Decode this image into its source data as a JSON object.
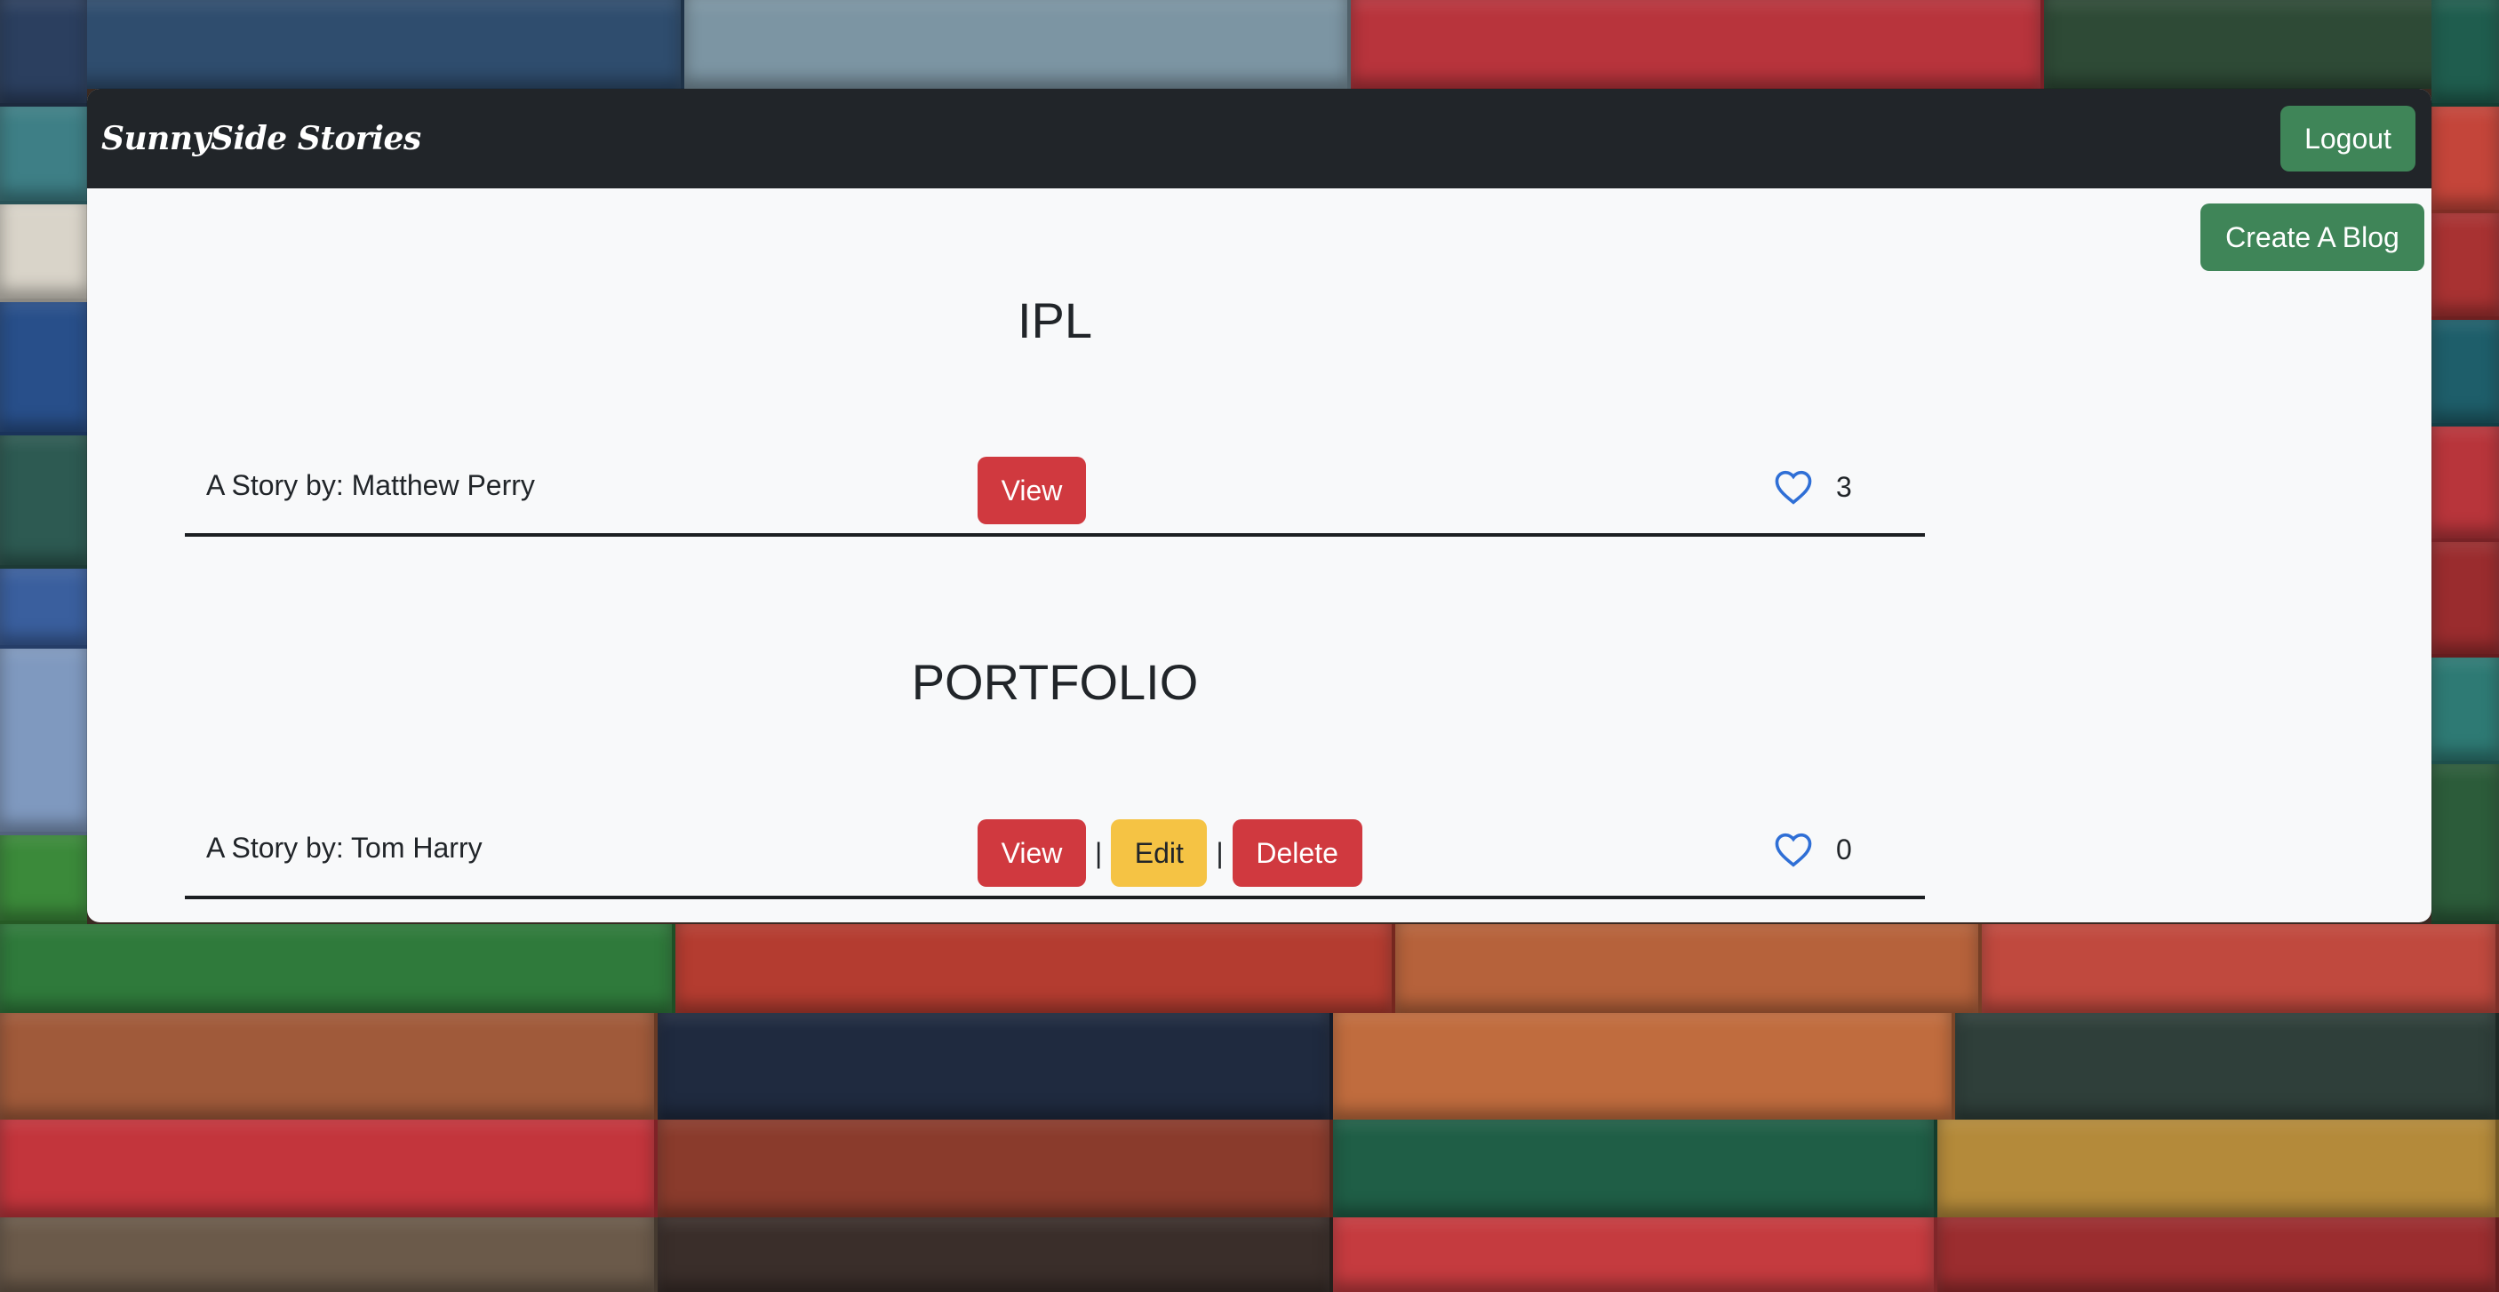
{
  "app": {
    "brand": "SunnySide Stories",
    "logout_label": "Logout",
    "create_label": "Create A Blog"
  },
  "posts": [
    {
      "title": "IPL",
      "author_text": "A Story by: Matthew Perry",
      "view_label": "View",
      "likes": "3"
    },
    {
      "title": "PORTFOLIO",
      "author_text": "A Story by: Tom Harry",
      "view_label": "View",
      "edit_label": "Edit",
      "delete_label": "Delete",
      "separator": "|",
      "likes": "0"
    }
  ],
  "icons": {
    "like": "heart-outline-icon"
  },
  "colors": {
    "navbar": "#212529",
    "card": "#f8f9fa",
    "success": "#3f8558",
    "danger": "#d0393f",
    "warning": "#f5c344",
    "heart": "#2f6fd6"
  }
}
